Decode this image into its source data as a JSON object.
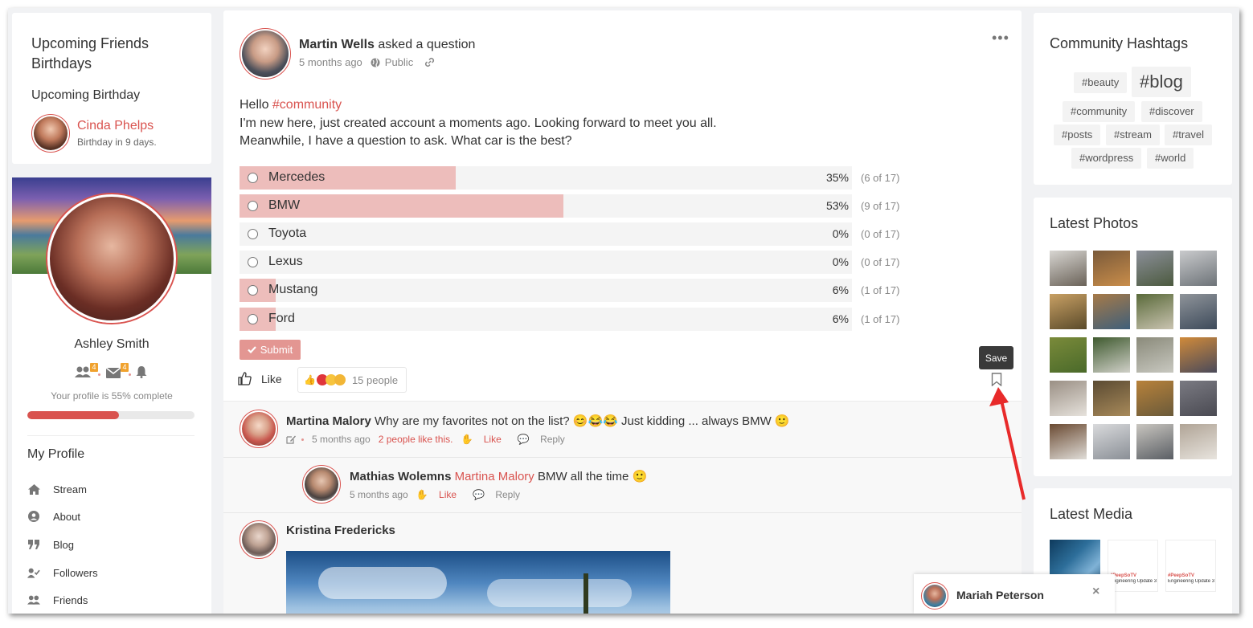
{
  "left": {
    "birthdays_title": "Upcoming Friends Birthdays",
    "birthday_sub": "Upcoming Birthday",
    "birthday_name": "Cinda Phelps",
    "birthday_text": "Birthday in 9 days.",
    "profile_name": "Ashley Smith",
    "friends_badge": "4",
    "messages_badge": "4",
    "complete_text": "Your profile is 55% complete",
    "complete_fraction": 0.55,
    "my_profile_title": "My Profile",
    "menu": [
      {
        "label": "Stream",
        "icon": "home-icon"
      },
      {
        "label": "About",
        "icon": "user-circle-icon"
      },
      {
        "label": "Blog",
        "icon": "quote-icon"
      },
      {
        "label": "Followers",
        "icon": "user-check-icon"
      },
      {
        "label": "Friends",
        "icon": "users-icon"
      }
    ]
  },
  "post": {
    "author": "Martin Wells",
    "action": "asked a question",
    "time": "5 months ago",
    "privacy": "Public",
    "line1_text": "Hello ",
    "line1_tag": "#community",
    "line2": "I'm new here, just created account a moments ago. Looking forward to meet you all.",
    "line3": "Meanwhile, I have a question to ask. What car is the best?",
    "poll": [
      {
        "label": "Mercedes",
        "pct": "35%",
        "count": "(6 of 17)",
        "fill": 0.353
      },
      {
        "label": "BMW",
        "pct": "53%",
        "count": "(9 of 17)",
        "fill": 0.529
      },
      {
        "label": "Toyota",
        "pct": "0%",
        "count": "(0 of 17)",
        "fill": 0
      },
      {
        "label": "Lexus",
        "pct": "0%",
        "count": "(0 of 17)",
        "fill": 0
      },
      {
        "label": "Mustang",
        "pct": "6%",
        "count": "(1 of 17)",
        "fill": 0.059
      },
      {
        "label": "Ford",
        "pct": "6%",
        "count": "(1 of 17)",
        "fill": 0.059
      }
    ],
    "submit_label": "Submit",
    "like_label": "Like",
    "reactions_count": "15 people",
    "save_tooltip": "Save"
  },
  "comments": [
    {
      "author": "Martina Malory",
      "text": "Why are my favorites not on the list? 😊😂😂 Just kidding ... always BMW 🙂",
      "time": "5 months ago",
      "likes": "2 people like this.",
      "like_label": "Like",
      "reply_label": "Reply"
    },
    {
      "author": "Mathias Wolemns",
      "mention": "Martina Malory",
      "text": "BMW all the time 🙂",
      "time": "5 months ago",
      "like_label": "Like",
      "reply_label": "Reply"
    },
    {
      "author": "Kristina Fredericks"
    }
  ],
  "right": {
    "hashtags_title": "Community Hashtags",
    "tags": [
      "#beauty",
      "#blog",
      "#community",
      "#discover",
      "#posts",
      "#stream",
      "#travel",
      "#wordpress",
      "#world"
    ],
    "photos_title": "Latest Photos",
    "media_title": "Latest Media",
    "media_caption_tag": "#PeepSoTV",
    "media_caption_text": "Engineering Update 3"
  },
  "chat": {
    "name": "Mariah Peterson",
    "close_icon": "×"
  },
  "colors": {
    "accent": "#d9534f",
    "poll_fill": "#edbdbb",
    "badge": "#f0a22e"
  }
}
